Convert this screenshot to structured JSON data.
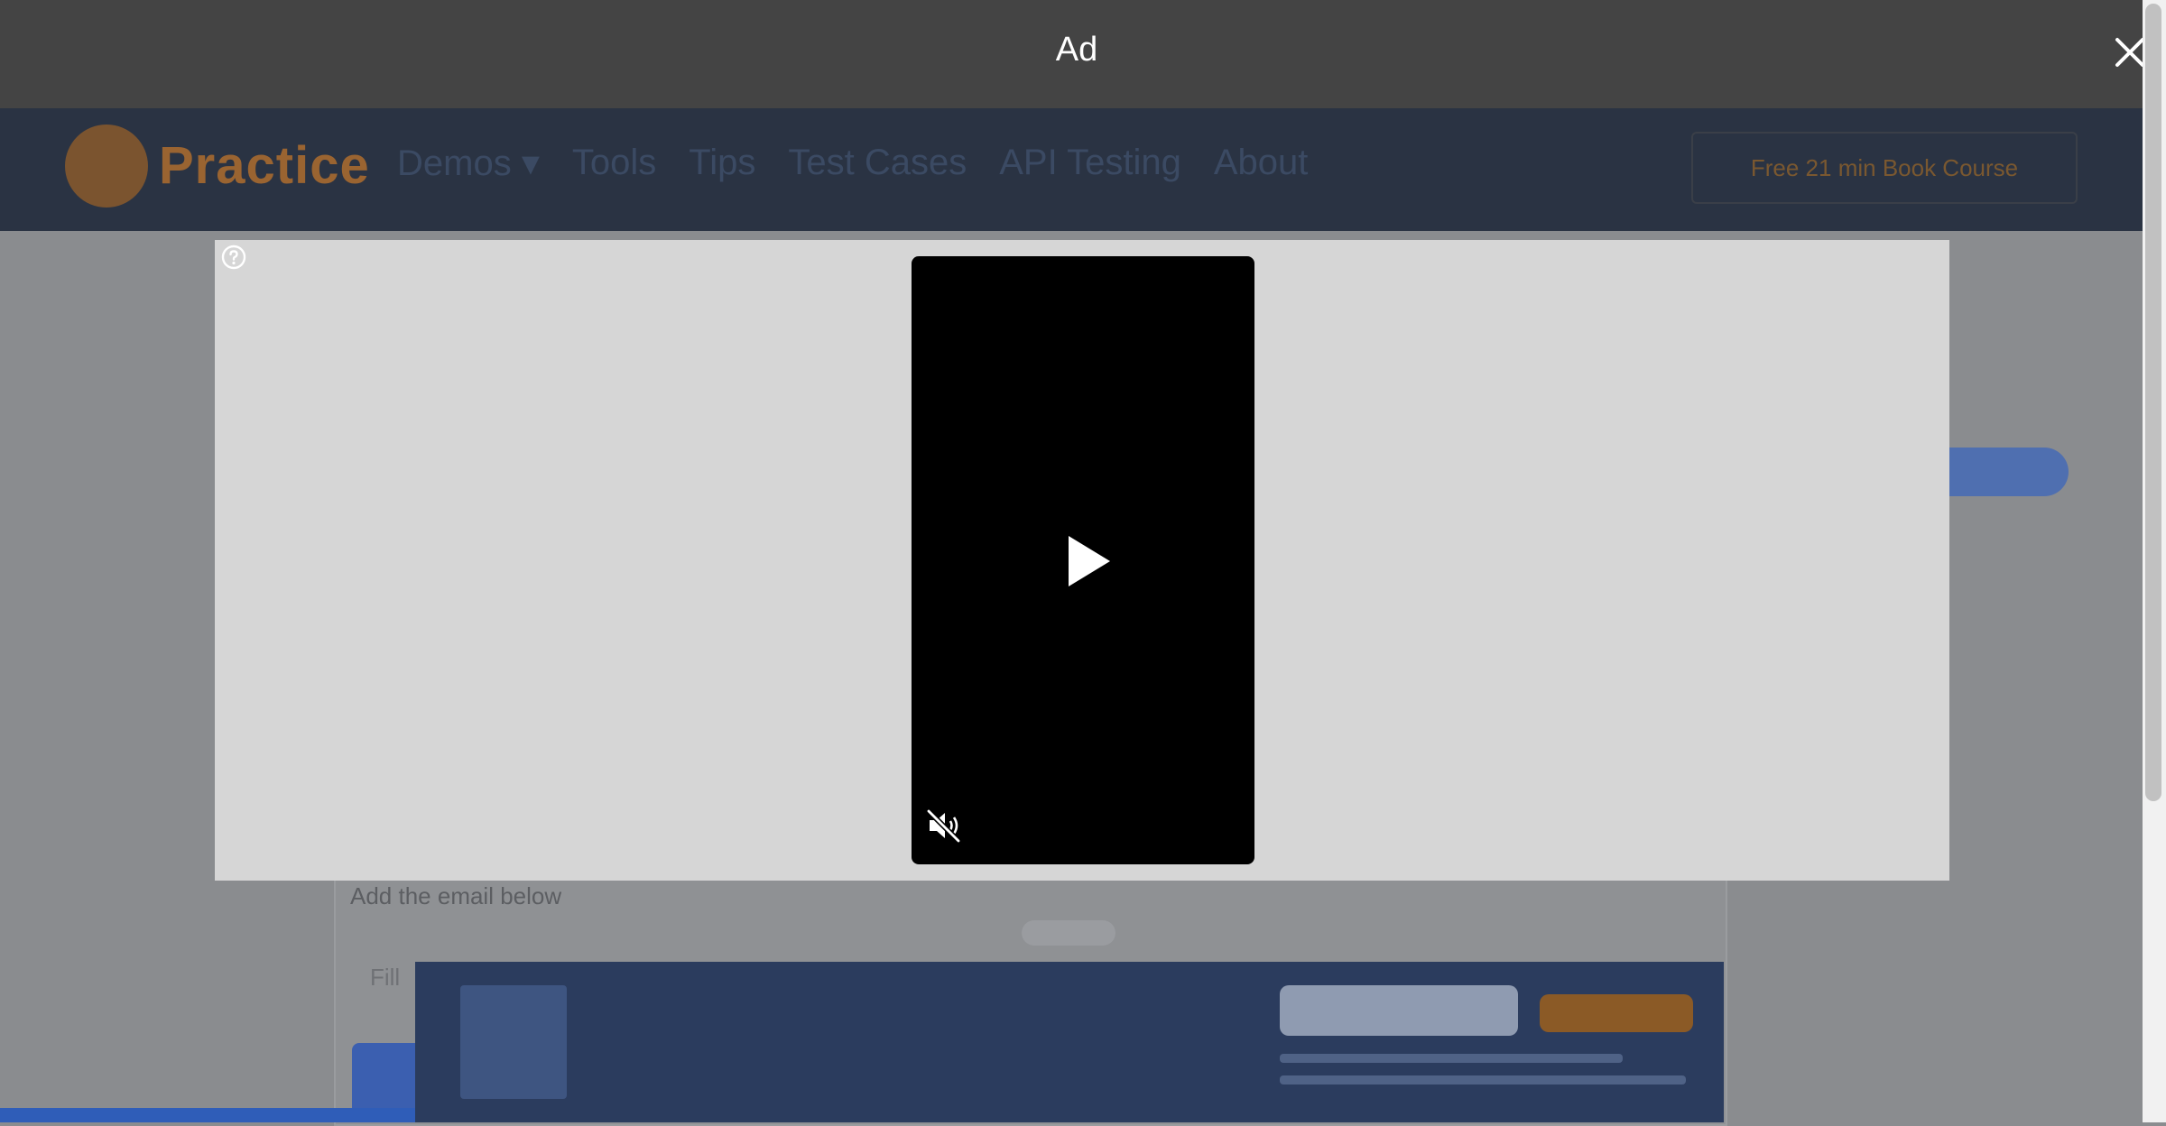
{
  "ad": {
    "label": "Ad",
    "close_icon": "close-icon",
    "info_icon": "question-circle-icon",
    "video": {
      "play_icon": "play-icon",
      "mute_icon": "muted-speaker-icon"
    }
  },
  "background_page": {
    "logo_text": "Practice",
    "nav_items": [
      "Demos ▾",
      "Tools",
      "Tips",
      "Test Cases",
      "API Testing",
      "About"
    ],
    "cta": "Free 21 min Book Course",
    "label": "Add the email below",
    "small_text": "Fill"
  },
  "colors": {
    "ad_bar": "#444444",
    "ad_panel": "#d6d6d6",
    "nav_bg": "#2a3343",
    "brand_orange": "#9a6431"
  }
}
